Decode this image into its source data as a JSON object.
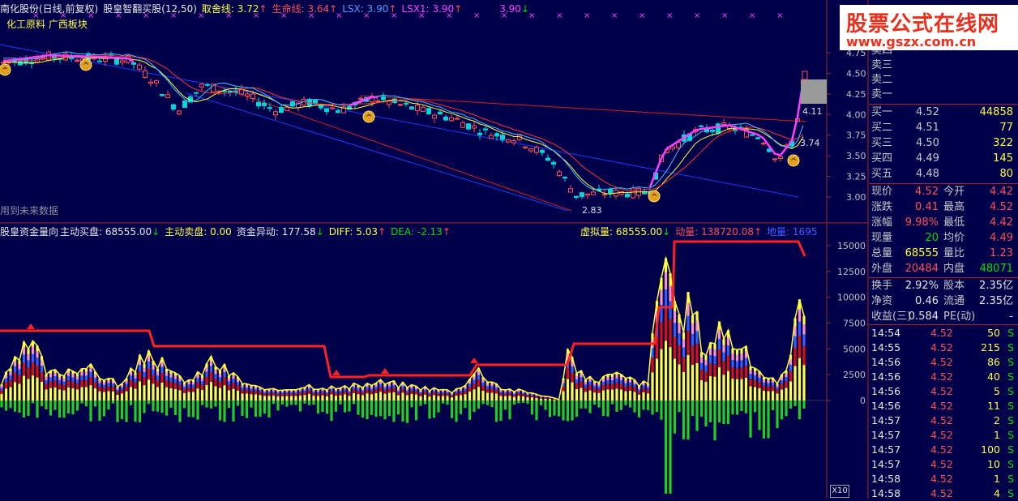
{
  "upper_header": {
    "stock": "南化股份(日线,前复权)",
    "indicator": "股皇智翻买股(12,50)",
    "qs_label": "取舍线:",
    "qs_value": "3.72",
    "qs_arrow": "↑",
    "sm_label": "生命线:",
    "sm_value": "3.64",
    "sm_arrow": "↑",
    "lsx_label": "LSX:",
    "lsx_value": "3.90",
    "lsx_arrow": "↑",
    "lsx1_label": "LSX1:",
    "lsx1_value": "3.90",
    "lsx1_arrow": "↑",
    "extra_value": "3.90",
    "extra_arrow": "↓"
  },
  "sector_label": "化工原料  广西板块",
  "future_data_label": "用到未来数据",
  "lower_header": {
    "name": "股皇资金量向",
    "buy_label": "主动买盘:",
    "buy_value": "68555.00",
    "buy_arrow": "↓",
    "sell_label": "主动卖盘:",
    "sell_value": "0.00",
    "flow_label": "资金异动:",
    "flow_value": "177.58",
    "flow_arrow": "↓",
    "diff_label": "DIFF:",
    "diff_value": "5.03",
    "diff_arrow": "↑",
    "dea_label": "DEA:",
    "dea_value": "-2.13",
    "dea_arrow": "↑",
    "virt_label": "虚拟量:",
    "virt_value": "68555.00",
    "virt_arrow": "↓",
    "mom_label": "动量:",
    "mom_value": "138720.08",
    "mom_arrow": "↑",
    "land_label": "地量:",
    "land_value": "1695"
  },
  "price_annotations": {
    "high_mark": "4.11",
    "cur_mark": "3.74",
    "low_mark": "2.83"
  },
  "upper_axis": [
    "4.75",
    "4.50",
    "4.25",
    "4.00",
    "3.75",
    "3.50",
    "3.25",
    "3.00"
  ],
  "lower_axis": [
    "15000",
    "12500",
    "10000",
    "7500",
    "5000",
    "2500",
    "0"
  ],
  "order_book": {
    "sell": [
      {
        "label": "卖四"
      },
      {
        "label": "卖三"
      },
      {
        "label": "卖二"
      },
      {
        "label": "卖一"
      }
    ],
    "buy": [
      {
        "label": "买一",
        "price": "4.52",
        "vol": "44858"
      },
      {
        "label": "买二",
        "price": "4.51",
        "vol": "77"
      },
      {
        "label": "买三",
        "price": "4.50",
        "vol": "322"
      },
      {
        "label": "买四",
        "price": "4.49",
        "vol": "145"
      },
      {
        "label": "买五",
        "price": "4.48",
        "vol": "80"
      }
    ]
  },
  "quote": [
    {
      "l1": "现价",
      "v1": "4.52",
      "c1": "red",
      "l2": "今开",
      "v2": "4.42",
      "c2": "red"
    },
    {
      "l1": "涨跌",
      "v1": "0.41",
      "c1": "red",
      "l2": "最高",
      "v2": "4.52",
      "c2": "red"
    },
    {
      "l1": "涨幅",
      "v1": "9.98%",
      "c1": "red",
      "l2": "最低",
      "v2": "4.42",
      "c2": "red"
    },
    {
      "l1": "现量",
      "v1": "20",
      "c1": "grn",
      "l2": "均价",
      "v2": "4.49",
      "c2": "red"
    },
    {
      "l1": "总量",
      "v1": "68555",
      "c1": "yel",
      "l2": "量比",
      "v2": "1.23",
      "c2": "red"
    },
    {
      "l1": "外盘",
      "v1": "20484",
      "c1": "red",
      "l2": "内盘",
      "v2": "48071",
      "c2": "grn"
    }
  ],
  "fundamentals": [
    {
      "l1": "换手",
      "v1": "2.92%",
      "l2": "股本",
      "v2": "2.35亿"
    },
    {
      "l1": "净资",
      "v1": "0.46",
      "l2": "流通",
      "v2": "2.35亿"
    },
    {
      "l1": "收益(三)",
      "v1": "0.584",
      "l2": "PE(动)",
      "v2": "-"
    }
  ],
  "ticks": [
    {
      "time": "14:54",
      "price": "4.52",
      "vol": "50",
      "side": "S"
    },
    {
      "time": "14:55",
      "price": "4.52",
      "vol": "215",
      "side": "S"
    },
    {
      "time": "14:56",
      "price": "4.52",
      "vol": "86",
      "side": "S"
    },
    {
      "time": "14:56",
      "price": "4.52",
      "vol": "40",
      "side": "S"
    },
    {
      "time": "14:56",
      "price": "4.52",
      "vol": "5",
      "side": "S"
    },
    {
      "time": "14:56",
      "price": "4.52",
      "vol": "11",
      "side": "S"
    },
    {
      "time": "14:57",
      "price": "4.52",
      "vol": "2",
      "side": "S"
    },
    {
      "time": "14:57",
      "price": "4.52",
      "vol": "1",
      "side": "S"
    },
    {
      "time": "14:57",
      "price": "4.52",
      "vol": "100",
      "side": "S"
    },
    {
      "time": "14:57",
      "price": "4.52",
      "vol": "10",
      "side": "S"
    },
    {
      "time": "14:58",
      "price": "4.52",
      "vol": "1",
      "side": "S"
    },
    {
      "time": "14:58",
      "price": "4.52",
      "vol": "4",
      "side": "S"
    }
  ],
  "watermark": {
    "title": "股票公式在线网",
    "url": "www.gszx.com.cn"
  },
  "scale_button": "X10",
  "colors": {
    "bg": "#00004a",
    "up": "#ff5050",
    "down": "#00e0e0",
    "yellow": "#ffff40",
    "magenta": "#ff40ff",
    "green": "#00e000",
    "red_line": "#ff2020"
  }
}
